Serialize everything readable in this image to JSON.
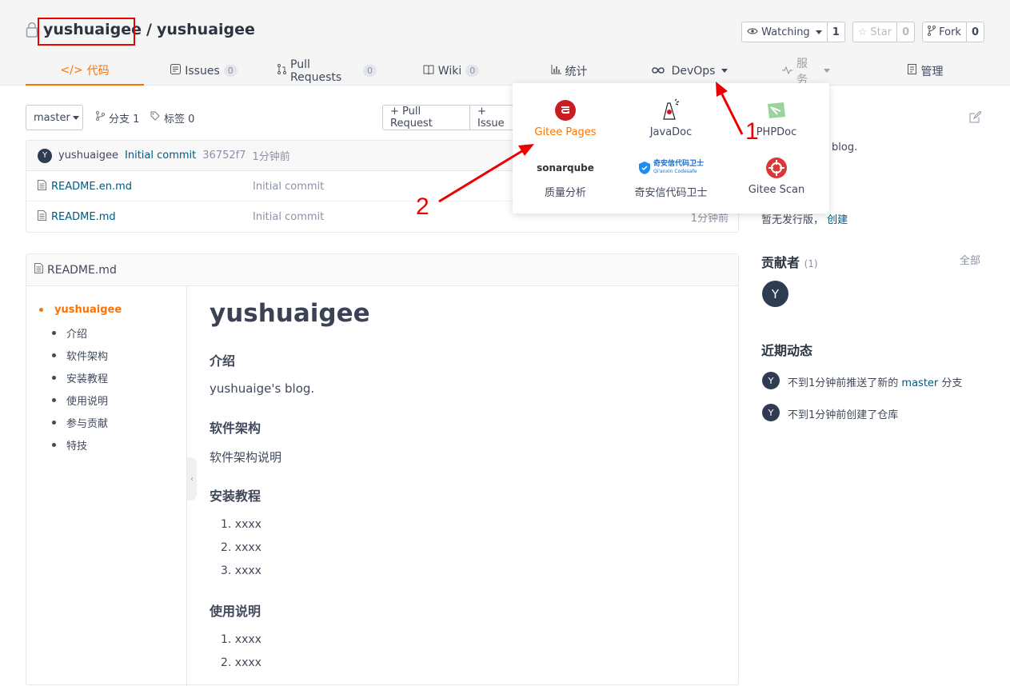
{
  "repo": {
    "owner": "yushuaigee",
    "separator": "/",
    "name": "yushuaigee"
  },
  "actions": {
    "watch": {
      "label": "Watching",
      "count": "1"
    },
    "star": {
      "label": "Star",
      "count": "0"
    },
    "fork": {
      "label": "Fork",
      "count": "0"
    }
  },
  "tabs": {
    "code": "代码",
    "issues": {
      "label": "Issues",
      "count": "0"
    },
    "pulls": {
      "label": "Pull Requests",
      "count": "0"
    },
    "wiki": {
      "label": "Wiki",
      "count": "0"
    },
    "stats": "统计",
    "devops": "DevOps",
    "services": "服务",
    "manage": "管理"
  },
  "branchbar": {
    "branch": "master",
    "branches": "分支 1",
    "tags": "标签 0",
    "pull_request": "+ Pull Request",
    "issue": "+ Issue"
  },
  "commit": {
    "avatar": "Y",
    "author": "yushuaigee",
    "message": "Initial commit",
    "sha": "36752f7",
    "time": "1分钟前"
  },
  "files": [
    {
      "name": "README.en.md",
      "message": "Initial commit",
      "time": ""
    },
    {
      "name": "README.md",
      "message": "Initial commit",
      "time": "1分钟前"
    }
  ],
  "readme": {
    "title": "README.md",
    "toc_main": "yushuaigee",
    "toc": [
      "介绍",
      "软件架构",
      "安装教程",
      "使用说明",
      "参与贡献",
      "特技"
    ],
    "h1": "yushuaigee",
    "h_intro": "介绍",
    "p_intro": "yushuaige's blog.",
    "h_arch": "软件架构",
    "p_arch": "软件架构说明",
    "h_install": "安装教程",
    "install_items": [
      "1. xxxx",
      "2. xxxx",
      "3. xxxx"
    ],
    "h_usage": "使用说明",
    "usage_items": [
      "1. xxxx",
      "2. xxxx"
    ]
  },
  "sidebar": {
    "intro_partial": "blog.",
    "release_text": "暂无发行版，",
    "release_link": "创建",
    "contributors_title": "贡献者",
    "contributors_count": "(1)",
    "contributors_all": "全部",
    "contributor_avatar": "Y",
    "activity_title": "近期动态",
    "activity": [
      {
        "avatar": "Y",
        "pre": "不到1分钟前推送了新的",
        "link": "master",
        "post": "分支"
      },
      {
        "avatar": "Y",
        "pre": "不到1分钟前创建了仓库",
        "link": "",
        "post": ""
      }
    ]
  },
  "devops_menu": {
    "gitee_pages": "Gitee Pages",
    "javadoc": "JavaDoc",
    "phpdoc": "PHPDoc",
    "sonarqube": "质量分析",
    "sonarqube_logo": "sonarqube",
    "qianxin": "奇安信代码卫士",
    "qianxin_logo": "奇安信代码卫士",
    "qianxin_sub": "Qi'anxin Codesafe",
    "gitee_scan": "Gitee Scan"
  },
  "annotations": {
    "one": "1",
    "two": "2"
  },
  "colors": {
    "accent": "#fe7300",
    "link": "#005980",
    "annotation": "#ee0000",
    "avatar": "#2e3c52"
  }
}
